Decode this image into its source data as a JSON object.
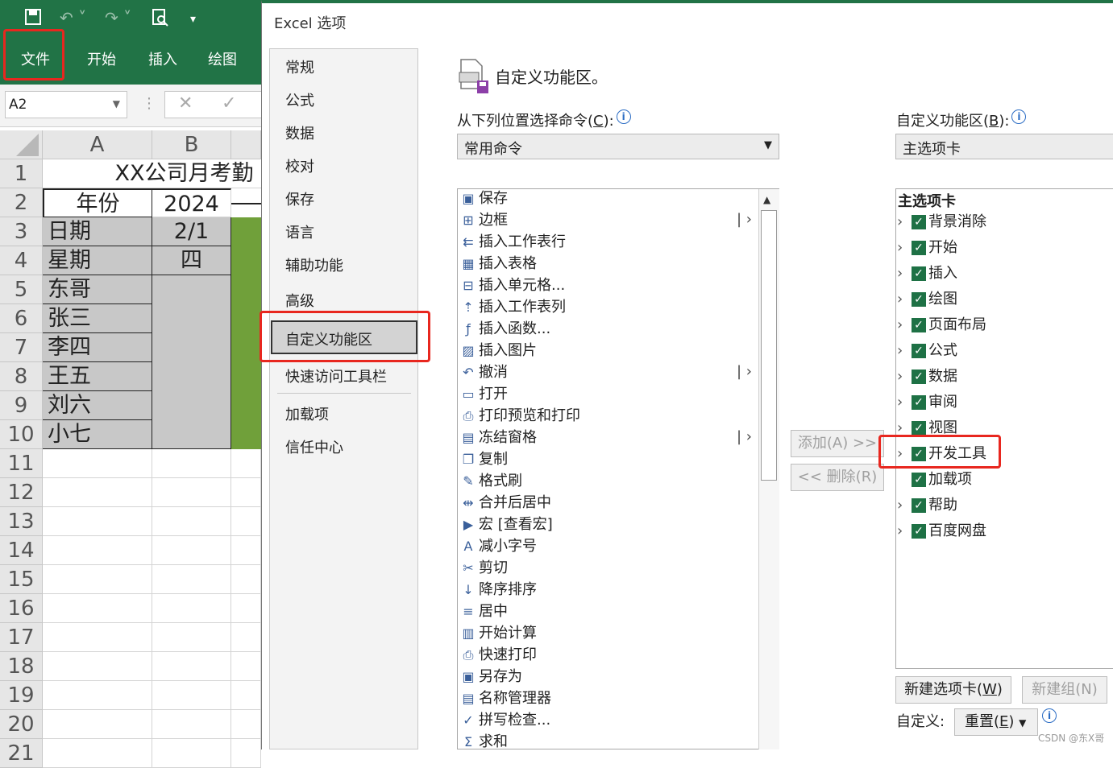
{
  "excel": {
    "tabs": [
      "文件",
      "开始",
      "插入",
      "绘图"
    ],
    "name_box": "A2",
    "columns": [
      "A",
      "B"
    ],
    "rows": [
      "1",
      "2",
      "3",
      "4",
      "5",
      "6",
      "7",
      "8",
      "9",
      "10",
      "11",
      "12",
      "13",
      "14",
      "15",
      "16",
      "17",
      "18",
      "19",
      "20",
      "21"
    ],
    "title_cell": "XX公司月考勤",
    "year_label": "年份",
    "year_value": "2024",
    "date_label": "日期",
    "date_value": "2/1",
    "weekday_label": "星期",
    "weekday_value": "四",
    "names": [
      "东哥",
      "张三",
      "李四",
      "王五",
      "刘六",
      "小七"
    ],
    "colors": {
      "ribbon": "#217346",
      "highlight": "#e8271f",
      "cell_green": "#70a03a"
    }
  },
  "dialog": {
    "title": "Excel 选项",
    "nav": [
      "常规",
      "公式",
      "数据",
      "校对",
      "保存",
      "语言",
      "辅助功能",
      "高级",
      "自定义功能区",
      "快速访问工具栏",
      "加载项",
      "信任中心"
    ],
    "selected_nav": "自定义功能区",
    "heading": "自定义功能区。",
    "choose_label": "从下列位置选择命令(",
    "choose_key": "C",
    "choose_suffix": "):",
    "choose_value": "常用命令",
    "customize_label": "自定义功能区(",
    "customize_key": "B",
    "customize_suffix": "):",
    "customize_value": "主选项卡",
    "commands": [
      {
        "icon": "save-icon",
        "label": "保存"
      },
      {
        "icon": "border-icon",
        "label": "边框",
        "submenu": true
      },
      {
        "icon": "insert-row-icon",
        "label": "插入工作表行"
      },
      {
        "icon": "table-icon",
        "label": "插入表格"
      },
      {
        "icon": "insert-cell-icon",
        "label": "插入单元格..."
      },
      {
        "icon": "insert-column-icon",
        "label": "插入工作表列"
      },
      {
        "icon": "function-icon",
        "label": "插入函数..."
      },
      {
        "icon": "picture-icon",
        "label": "插入图片"
      },
      {
        "icon": "undo-icon",
        "label": "撤消",
        "submenu": true
      },
      {
        "icon": "folder-icon",
        "label": "打开"
      },
      {
        "icon": "print-preview-icon",
        "label": "打印预览和打印"
      },
      {
        "icon": "freeze-panes-icon",
        "label": "冻结窗格",
        "submenu": true
      },
      {
        "icon": "copy-icon",
        "label": "复制"
      },
      {
        "icon": "format-painter-icon",
        "label": "格式刷"
      },
      {
        "icon": "merge-center-icon",
        "label": "合并后居中"
      },
      {
        "icon": "macro-icon",
        "label": "宏 [查看宏]"
      },
      {
        "icon": "decrease-font-icon",
        "label": "减小字号"
      },
      {
        "icon": "cut-icon",
        "label": "剪切"
      },
      {
        "icon": "sort-desc-icon",
        "label": "降序排序"
      },
      {
        "icon": "center-icon",
        "label": "居中"
      },
      {
        "icon": "calculate-icon",
        "label": "开始计算"
      },
      {
        "icon": "quick-print-icon",
        "label": "快速打印"
      },
      {
        "icon": "save-as-icon",
        "label": "另存为"
      },
      {
        "icon": "name-manager-icon",
        "label": "名称管理器"
      },
      {
        "icon": "spelling-icon",
        "label": "拼写检查..."
      },
      {
        "icon": "sum-icon",
        "label": "求和"
      }
    ],
    "add_button": "添加(A) >>",
    "remove_button": "<< 删除(R)",
    "tree_header": "主选项卡",
    "tree": [
      {
        "label": "背景消除",
        "checked": true,
        "expandable": true
      },
      {
        "label": "开始",
        "checked": true,
        "expandable": true
      },
      {
        "label": "插入",
        "checked": true,
        "expandable": true
      },
      {
        "label": "绘图",
        "checked": true,
        "expandable": true
      },
      {
        "label": "页面布局",
        "checked": true,
        "expandable": true
      },
      {
        "label": "公式",
        "checked": true,
        "expandable": true
      },
      {
        "label": "数据",
        "checked": true,
        "expandable": true
      },
      {
        "label": "审阅",
        "checked": true,
        "expandable": true
      },
      {
        "label": "视图",
        "checked": true,
        "expandable": true
      },
      {
        "label": "开发工具",
        "checked": true,
        "expandable": true
      },
      {
        "label": "加载项",
        "checked": true,
        "expandable": false
      },
      {
        "label": "帮助",
        "checked": true,
        "expandable": true
      },
      {
        "label": "百度网盘",
        "checked": true,
        "expandable": true
      }
    ],
    "new_tab_prefix": "新建选项卡(",
    "new_tab_key": "W",
    "new_tab_suffix": ")",
    "new_group_button": "新建组(N)",
    "customize_footer_label": "自定义:",
    "reset_prefix": "重置(",
    "reset_key": "E",
    "reset_suffix": ")",
    "watermark": "CSDN @东X哥"
  }
}
